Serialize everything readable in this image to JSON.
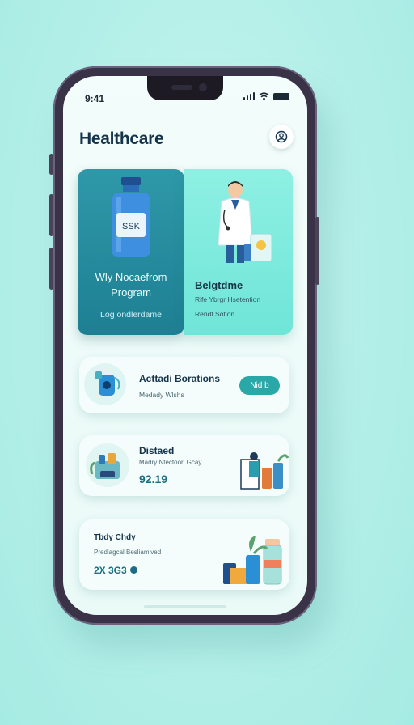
{
  "status_bar": {
    "time": "9:41"
  },
  "header": {
    "title": "Healthcare",
    "profile_icon": "user-icon"
  },
  "cards": {
    "primary": {
      "bottle_label": "SSK",
      "title_line1": "Wly Nocaefrom",
      "title_line2": "Program",
      "subtitle": "Log ondlerdame"
    },
    "secondary": {
      "title": "Belgtdme",
      "line1": "Rife Ybrgr Hsetention",
      "line2": "Rendt Sotion"
    }
  },
  "rows": [
    {
      "title": "Acttadi Borations",
      "subtitle": "Medady Wlshs",
      "button": "Nid b",
      "icon": "oxygen-device-icon"
    },
    {
      "title": "Distaed",
      "subtitle": "Madry Ntecfoori Gcay",
      "value": "92.19",
      "icon": "pharmacy-icon"
    },
    {
      "title": "Tbdy Chdy",
      "subtitle": "Prediagcal Besliamived",
      "badge": "2X 3G3",
      "icon": "medicine-bottles-icon"
    }
  ],
  "colors": {
    "accent": "#2aa7a7",
    "primary_card": "#2e98a9",
    "secondary_card": "#8ef0e3",
    "heading": "#15334a",
    "background": "#b3efe8"
  }
}
